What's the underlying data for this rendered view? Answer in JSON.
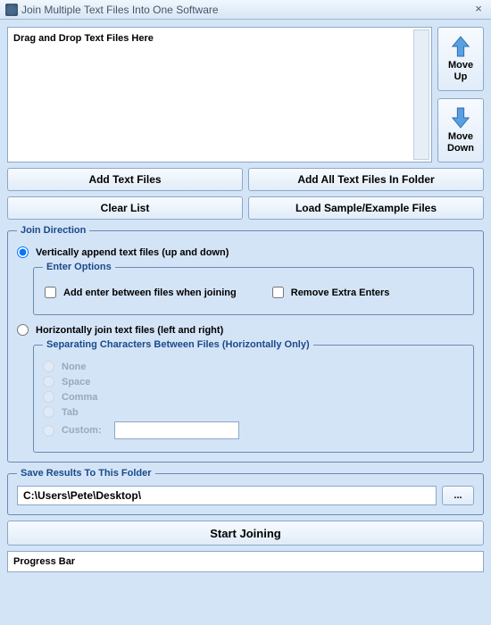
{
  "titlebar": {
    "title": "Join Multiple Text Files Into One Software",
    "close": "×"
  },
  "file_list": {
    "placeholder": "Drag and Drop Text Files Here"
  },
  "move": {
    "up": "Move\nUp",
    "down": "Move\nDown"
  },
  "buttons": {
    "add_files": "Add Text Files",
    "add_folder": "Add All Text Files In Folder",
    "clear": "Clear List",
    "load_sample": "Load Sample/Example Files",
    "browse": "...",
    "start": "Start Joining"
  },
  "join_direction": {
    "legend": "Join Direction",
    "vertical": "Vertically append text files (up and down)",
    "horizontal": "Horizontally join text files (left and right)"
  },
  "enter_options": {
    "legend": "Enter Options",
    "add_enter": "Add enter between files when joining",
    "remove_extra": "Remove Extra Enters"
  },
  "sep_options": {
    "legend": "Separating Characters Between Files (Horizontally Only)",
    "none": "None",
    "space": "Space",
    "comma": "Comma",
    "tab": "Tab",
    "custom": "Custom:"
  },
  "save": {
    "legend": "Save Results To This Folder",
    "path": "C:\\Users\\Pete\\Desktop\\"
  },
  "progress": {
    "label": "Progress Bar"
  }
}
